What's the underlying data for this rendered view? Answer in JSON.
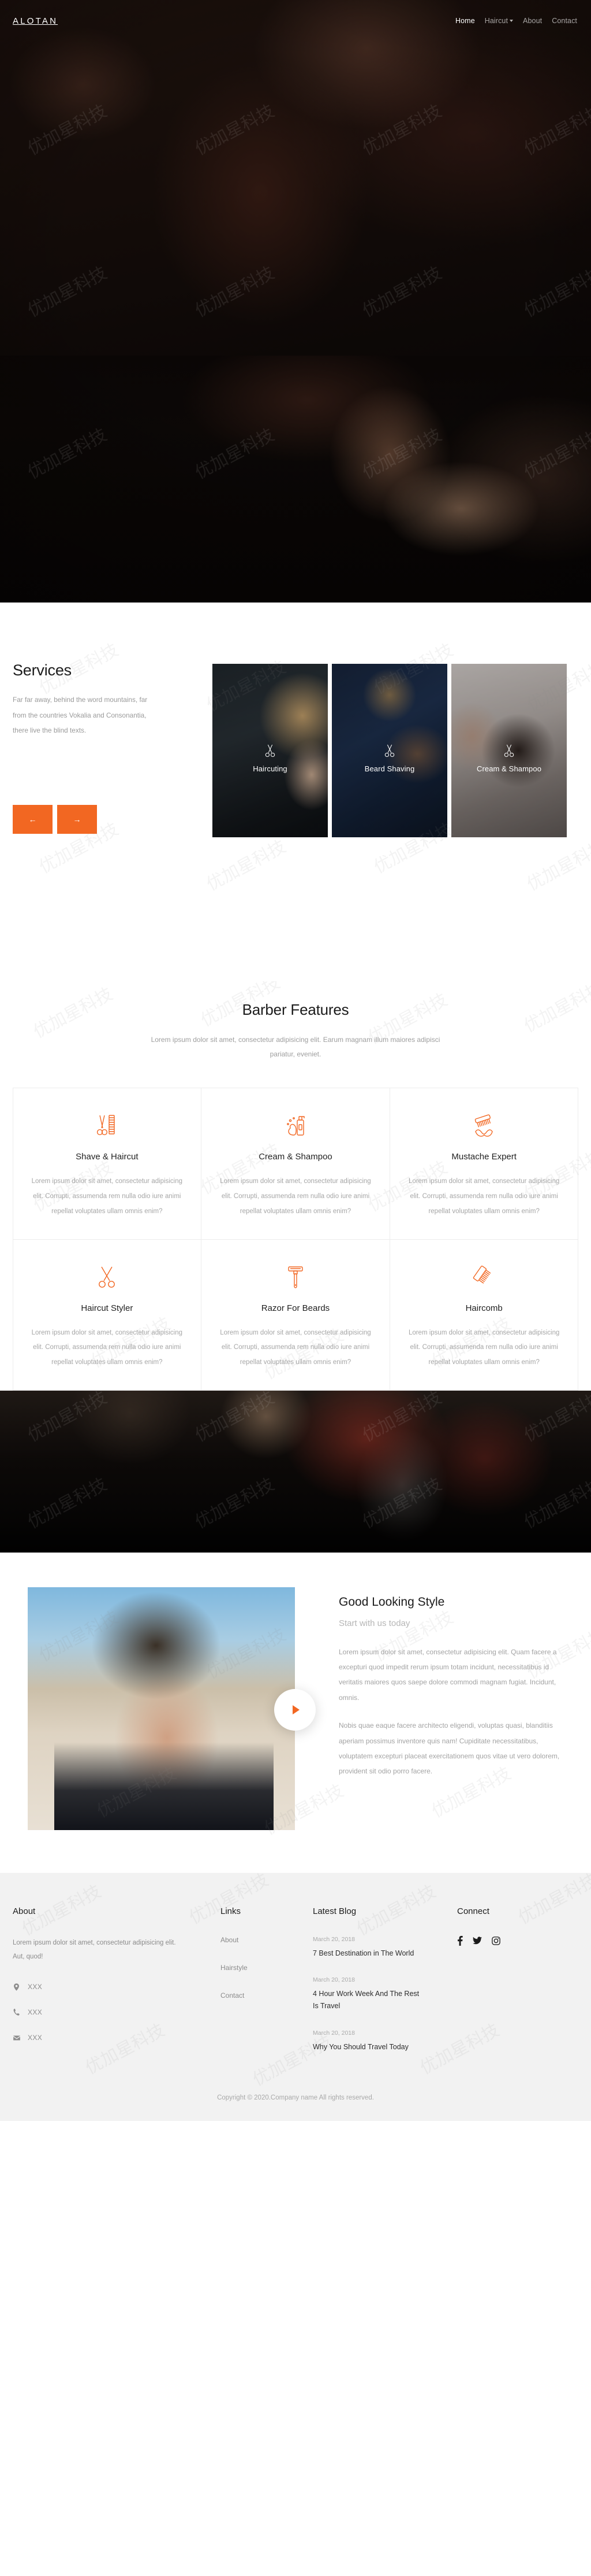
{
  "site": {
    "brand": "ALOTAN",
    "accent_color": "#F26722",
    "footer_bg": "#F2F2F2"
  },
  "nav": {
    "items": [
      {
        "label": "Home",
        "active": true,
        "has_dropdown": false
      },
      {
        "label": "Haircut",
        "active": false,
        "has_dropdown": true
      },
      {
        "label": "About",
        "active": false,
        "has_dropdown": false
      },
      {
        "label": "Contact",
        "active": false,
        "has_dropdown": false
      }
    ]
  },
  "services": {
    "title": "Services",
    "description": "Far far away, behind the word mountains, far from the countries Vokalia and Consonantia, there live the blind texts.",
    "prev_label": "←",
    "next_label": "→",
    "cards": [
      {
        "label": "Haircuting",
        "icon": "scissors-icon"
      },
      {
        "label": "Beard Shaving",
        "icon": "scissors-icon"
      },
      {
        "label": "Cream & Shampoo",
        "icon": "scissors-icon"
      }
    ]
  },
  "features": {
    "title": "Barber Features",
    "subtitle": "Lorem ipsum dolor sit amet, consectetur adipisicing elit. Earum magnam illum maiores adipisci pariatur, eveniet.",
    "body": "Lorem ipsum dolor sit amet, consectetur adipisicing elit. Corrupti, assumenda rem nulla odio iure animi repellat voluptates ullam omnis enim?",
    "cards": [
      {
        "name": "Shave & Haircut",
        "icon": "scissors-comb-icon"
      },
      {
        "name": "Cream & Shampoo",
        "icon": "shampoo-bottle-icon"
      },
      {
        "name": "Mustache Expert",
        "icon": "mustache-brush-icon"
      },
      {
        "name": "Haircut Styler",
        "icon": "scissors-icon"
      },
      {
        "name": "Razor For Beards",
        "icon": "razor-icon"
      },
      {
        "name": "Haircomb",
        "icon": "haircomb-icon"
      }
    ]
  },
  "good_looking": {
    "title": "Good Looking Style",
    "subtitle": "Start with us today",
    "paragraph1": "Lorem ipsum dolor sit amet, consectetur adipisicing elit. Quam facere a excepturi quod impedit rerum ipsum totam incidunt, necessitatibus id veritatis maiores quos saepe dolore commodi magnam fugiat. Incidunt, omnis.",
    "paragraph2": "Nobis quae eaque facere architecto eligendi, voluptas quasi, blanditiis aperiam possimus inventore quis nam! Cupiditate necessitatibus, voluptatem excepturi placeat exercitationem quos vitae ut vero dolorem, provident sit odio porro facere.",
    "play_label": "play-button"
  },
  "footer": {
    "about": {
      "heading": "About",
      "text": "Lorem ipsum dolor sit amet, consectetur adipisicing elit. Aut, quod!",
      "contacts": [
        {
          "icon": "map-pin-icon",
          "value": "XXX"
        },
        {
          "icon": "phone-icon",
          "value": "XXX"
        },
        {
          "icon": "email-icon",
          "value": "XXX"
        }
      ]
    },
    "links": {
      "heading": "Links",
      "items": [
        "About",
        "Hairstyle",
        "Contact"
      ]
    },
    "blog": {
      "heading": "Latest Blog",
      "posts": [
        {
          "date": "March 20, 2018",
          "title": "7 Best Destination in The World"
        },
        {
          "date": "March 20, 2018",
          "title": "4 Hour Work Week And The Rest Is Travel"
        },
        {
          "date": "March 20, 2018",
          "title": "Why You Should Travel Today"
        }
      ]
    },
    "connect": {
      "heading": "Connect",
      "socials": [
        {
          "name": "facebook-icon"
        },
        {
          "name": "twitter-icon"
        },
        {
          "name": "instagram-icon"
        }
      ]
    },
    "copyright": "Copyright © 2020.Company name All rights reserved."
  }
}
